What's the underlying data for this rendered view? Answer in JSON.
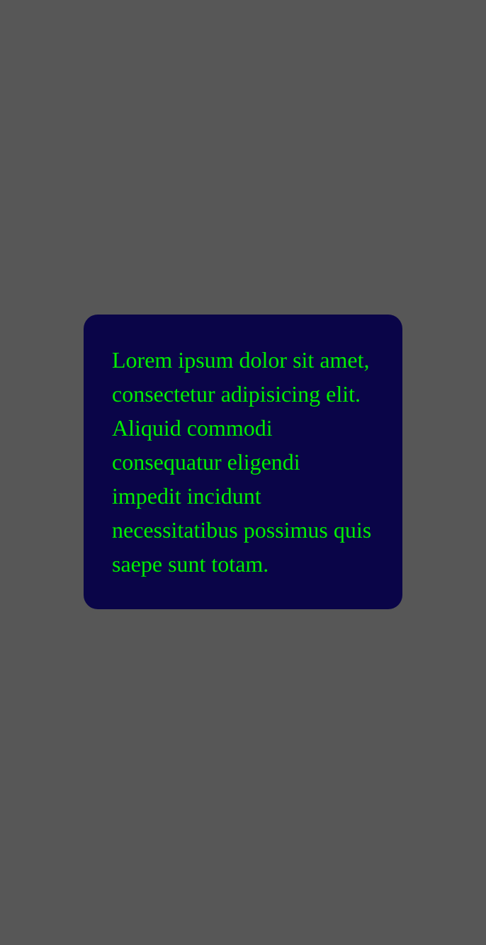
{
  "card": {
    "text": "Lorem ipsum dolor sit amet, consectetur adipisicing elit. Aliquid commodi consequatur eligendi impedit incidunt necessitatibus possimus quis saepe sunt totam."
  },
  "colors": {
    "background": "#575757",
    "card_background": "#0a0548",
    "text": "#00ee00"
  }
}
